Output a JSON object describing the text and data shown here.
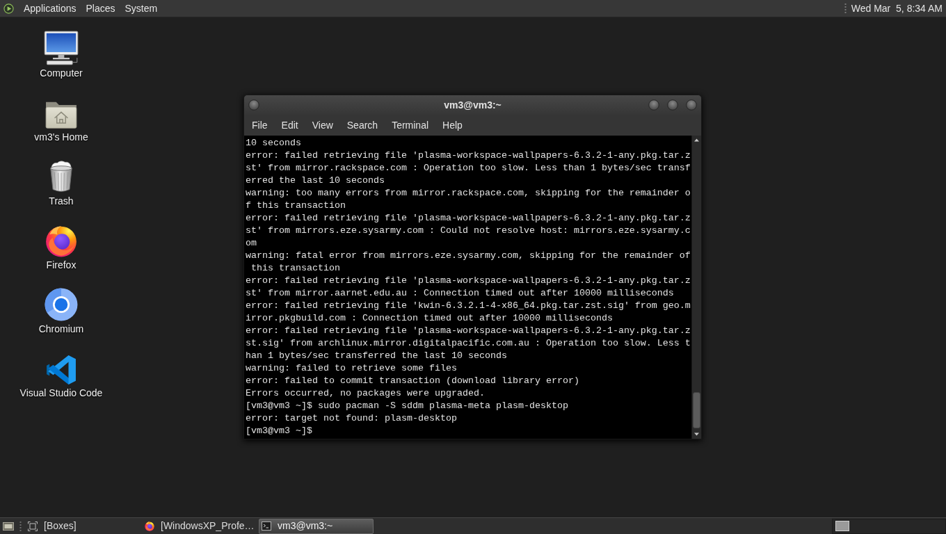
{
  "top_panel": {
    "menus": [
      "Applications",
      "Places",
      "System"
    ],
    "clock": "Wed Mar  5, 8:34 AM"
  },
  "desktop_icons": [
    {
      "label": "Computer",
      "kind": "computer"
    },
    {
      "label": "vm3's Home",
      "kind": "home"
    },
    {
      "label": "Trash",
      "kind": "trash"
    },
    {
      "label": "Firefox",
      "kind": "firefox"
    },
    {
      "label": "Chromium",
      "kind": "chromium"
    },
    {
      "label": "Visual Studio Code",
      "kind": "vscode"
    }
  ],
  "terminal": {
    "title": "vm3@vm3:~",
    "menu": [
      "File",
      "Edit",
      "View",
      "Search",
      "Terminal",
      "Help"
    ],
    "lines": [
      "10 seconds",
      "error: failed retrieving file 'plasma-workspace-wallpapers-6.3.2-1-any.pkg.tar.z",
      "st' from mirror.rackspace.com : Operation too slow. Less than 1 bytes/sec transf",
      "erred the last 10 seconds",
      "warning: too many errors from mirror.rackspace.com, skipping for the remainder o",
      "f this transaction",
      "error: failed retrieving file 'plasma-workspace-wallpapers-6.3.2-1-any.pkg.tar.z",
      "st' from mirrors.eze.sysarmy.com : Could not resolve host: mirrors.eze.sysarmy.c",
      "om",
      "warning: fatal error from mirrors.eze.sysarmy.com, skipping for the remainder of",
      " this transaction",
      "error: failed retrieving file 'plasma-workspace-wallpapers-6.3.2-1-any.pkg.tar.z",
      "st' from mirror.aarnet.edu.au : Connection timed out after 10000 milliseconds",
      "error: failed retrieving file 'kwin-6.3.2.1-4-x86_64.pkg.tar.zst.sig' from geo.m",
      "irror.pkgbuild.com : Connection timed out after 10000 milliseconds",
      "error: failed retrieving file 'plasma-workspace-wallpapers-6.3.2-1-any.pkg.tar.z",
      "st.sig' from archlinux.mirror.digitalpacific.com.au : Operation too slow. Less t",
      "han 1 bytes/sec transferred the last 10 seconds",
      "warning: failed to retrieve some files",
      "error: failed to commit transaction (download library error)",
      "Errors occurred, no packages were upgraded.",
      "[vm3@vm3 ~]$ sudo pacman -S sddm plasma-meta plasm-desktop",
      "error: target not found: plasm-desktop",
      "[vm3@vm3 ~]$"
    ]
  },
  "taskbar": {
    "tasks": [
      {
        "label": "[Boxes]",
        "kind": "boxes",
        "selected": false
      },
      {
        "label": "[WindowsXP_Profe…",
        "kind": "browser",
        "selected": false
      },
      {
        "label": "vm3@vm3:~",
        "kind": "terminal",
        "selected": true
      }
    ]
  }
}
